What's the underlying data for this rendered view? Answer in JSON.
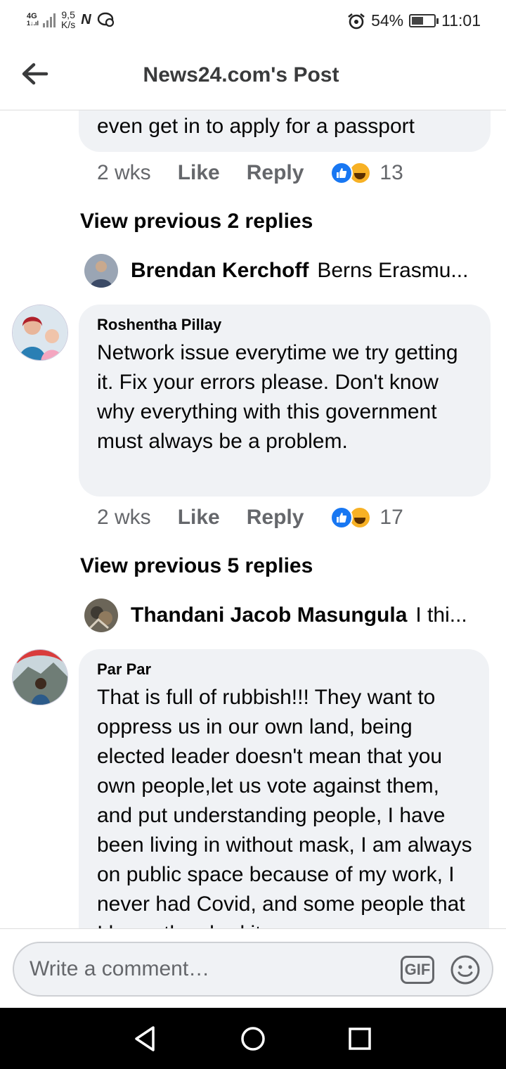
{
  "status_bar": {
    "network": "4G",
    "signal_sub": "1↓.ıl",
    "speed_value": "9,5",
    "speed_unit": "K/s",
    "battery_percent": "54%",
    "battery_level": 0.54,
    "time": "11:01"
  },
  "header": {
    "title": "News24.com's Post"
  },
  "comments": [
    {
      "text": "even get in to apply for a passport",
      "time": "2 wks",
      "like": "Like",
      "reply": "Reply",
      "reaction_count": "13",
      "view_previous": "View previous 2 replies",
      "reply_preview": {
        "name": "Brendan Kerchoff",
        "snippet": "Berns Erasmu..."
      }
    },
    {
      "author": "Roshentha Pillay",
      "text": "Network issue everytime we try getting it. Fix your errors please. Don't know why everything with this government must always be a problem.",
      "time": "2 wks",
      "like": "Like",
      "reply": "Reply",
      "reaction_count": "17",
      "view_previous": "View previous 5 replies",
      "reply_preview": {
        "name": "Thandani Jacob Masungula",
        "snippet": "I thi..."
      }
    },
    {
      "author": "Par Par",
      "text": "That is full of rubbish!!! They want to oppress us in our own land, being elected leader doesn't mean that you own people,let us vote against them, and  put understanding people, I have been living in without mask, I am always on public space because of my work, I never had Covid, and some people that I know they had it"
    }
  ],
  "composer": {
    "placeholder": "Write a comment…",
    "gif_label": "GIF"
  },
  "colors": {
    "accent": "#1877f2",
    "bubble": "#f0f2f5",
    "secondary_text": "#65676b"
  }
}
